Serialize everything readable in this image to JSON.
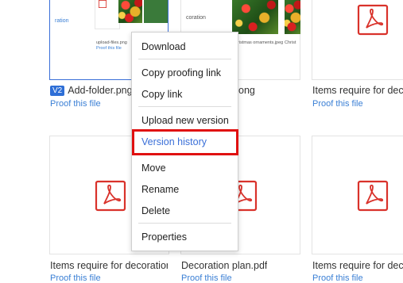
{
  "grid": {
    "row1": {
      "card1": {
        "version_badge": "V2",
        "name": "Add-folder.png",
        "proof_link": "Proof this file",
        "preview": {
          "partial_label": "ration",
          "mini_files": [
            {
              "name": "upload-files.png",
              "link": "Proof this file"
            }
          ]
        }
      },
      "card2": {
        "name_suffix": "ong",
        "preview": {
          "partial_label": "coration",
          "mini_files": [
            {
              "name": "Christmas ornaments.jpeg"
            },
            {
              "name": "Christ"
            }
          ]
        }
      },
      "card3": {
        "name": "Items require for decoration",
        "proof_link": "Proof this file"
      }
    },
    "row2": {
      "card1": {
        "name": "Items require for decoration",
        "proof_link": "Proof this file"
      },
      "card2": {
        "name": "Decoration plan.pdf",
        "proof_link": "Proof this file"
      },
      "card3": {
        "name": "Items require for decoration",
        "proof_link": "Proof this file"
      }
    }
  },
  "context_menu": {
    "items": [
      {
        "label": "Download"
      },
      {
        "label": "Copy proofing link"
      },
      {
        "label": "Copy link"
      },
      {
        "label": "Upload new version"
      },
      {
        "label": "Version history"
      },
      {
        "label": "Move"
      },
      {
        "label": "Rename"
      },
      {
        "label": "Delete"
      },
      {
        "label": "Properties"
      }
    ],
    "highlighted_item": "Version history"
  },
  "colors": {
    "accent": "#3a6fd8",
    "link": "#3a7fd5",
    "pdf_red": "#d9322b",
    "highlight_box": "#e01010"
  }
}
